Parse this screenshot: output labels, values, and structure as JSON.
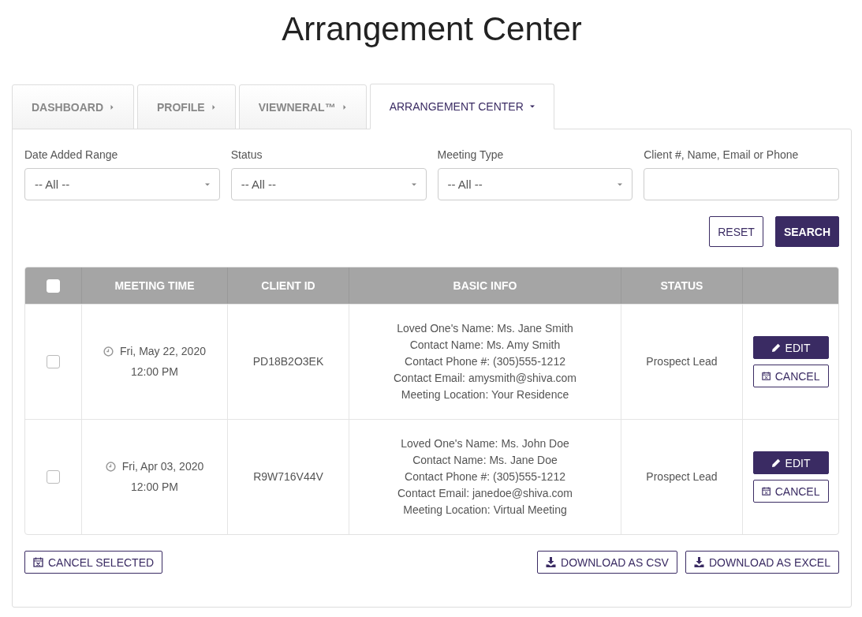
{
  "title": "Arrangement Center",
  "tabs": [
    {
      "label": "DASHBOARD",
      "selected": false
    },
    {
      "label": "PROFILE",
      "selected": false
    },
    {
      "label": "VIEWNERAL™",
      "selected": false
    },
    {
      "label": "ARRANGEMENT CENTER",
      "selected": true
    }
  ],
  "filters": [
    {
      "label": "Date Added Range",
      "kind": "select",
      "value": "-- All --"
    },
    {
      "label": "Status",
      "kind": "select",
      "value": "-- All --"
    },
    {
      "label": "Meeting Type",
      "kind": "select",
      "value": "-- All --"
    },
    {
      "label": "Client #, Name, Email or Phone",
      "kind": "text"
    }
  ],
  "filter_buttons": {
    "reset": "RESET",
    "search": "SEARCH"
  },
  "table": {
    "select_all_checked": false,
    "columns": [
      "MEETING TIME",
      "CLIENT ID",
      "BASIC INFO",
      "STATUS"
    ],
    "rows": [
      {
        "checked": false,
        "date": "Fri, May 22, 2020",
        "time": "12:00 PM",
        "client_id": "PD18B2O3EK",
        "info": [
          "Loved One's Name: Ms. Jane Smith",
          "Contact Name: Ms. Amy Smith",
          "Contact Phone #: (305)555-1212",
          "Contact Email: amysmith@shiva.com",
          "Meeting Location: Your Residence"
        ],
        "status": "Prospect Lead",
        "edit": "EDIT",
        "cancel": "CANCEL"
      },
      {
        "checked": false,
        "date": "Fri, Apr 03, 2020",
        "time": "12:00 PM",
        "client_id": "R9W716V44V",
        "info": [
          "Loved One's Name: Ms. John Doe",
          "Contact Name: Ms. Jane Doe",
          "Contact Phone #: (305)555-1212",
          "Contact Email: janedoe@shiva.com",
          "Meeting Location: Virtual Meeting"
        ],
        "status": "Prospect Lead",
        "edit": "EDIT",
        "cancel": "CANCEL"
      }
    ]
  },
  "footer": {
    "cancel_selected": "CANCEL SELECTED",
    "downloads": [
      "DOWNLOAD AS CSV",
      "DOWNLOAD AS EXCEL"
    ]
  }
}
